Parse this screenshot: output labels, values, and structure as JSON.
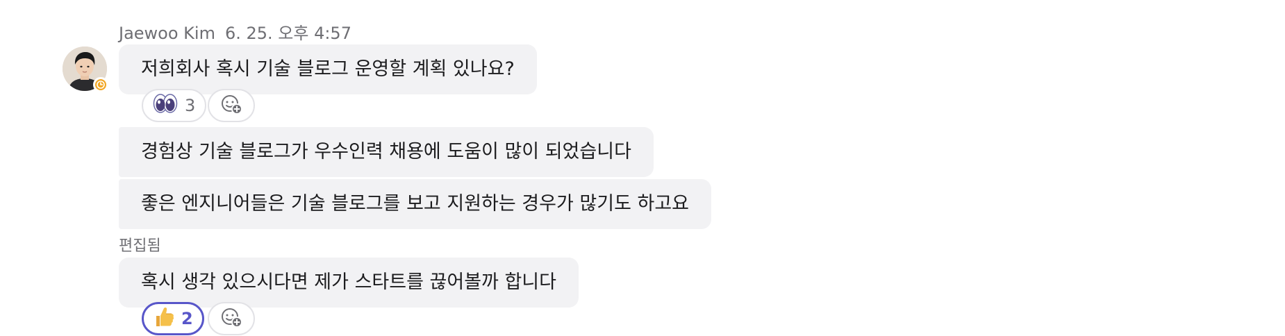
{
  "message_group": {
    "sender": "Jaewoo Kim",
    "timestamp": "6. 25. 오후 4:57",
    "avatar_status_icon": "clock-icon",
    "accent_color": "#5856c9",
    "status_color": "#f2a623",
    "messages": [
      {
        "text": "저희회사 혹시 기술 블로그 운영할 계획 있나요?",
        "reactions": [
          {
            "icon": "eyes-emoji-icon",
            "count": "3",
            "mine": false
          }
        ]
      },
      {
        "text": "경험상 기술 블로그가 우수인력 채용에 도움이 많이 되었습니다"
      },
      {
        "text": "좋은 엔지니어들은 기술 블로그를 보고 지원하는 경우가 많기도 하고요"
      },
      {
        "edited_label": "편집됨",
        "text": "혹시 생각 있으시다면 제가 스타트를 끊어볼까 합니다",
        "reactions": [
          {
            "icon": "thumbs-up-emoji-icon",
            "count": "2",
            "mine": true
          }
        ]
      }
    ],
    "add_reaction_icon": "add-emoji-icon"
  }
}
